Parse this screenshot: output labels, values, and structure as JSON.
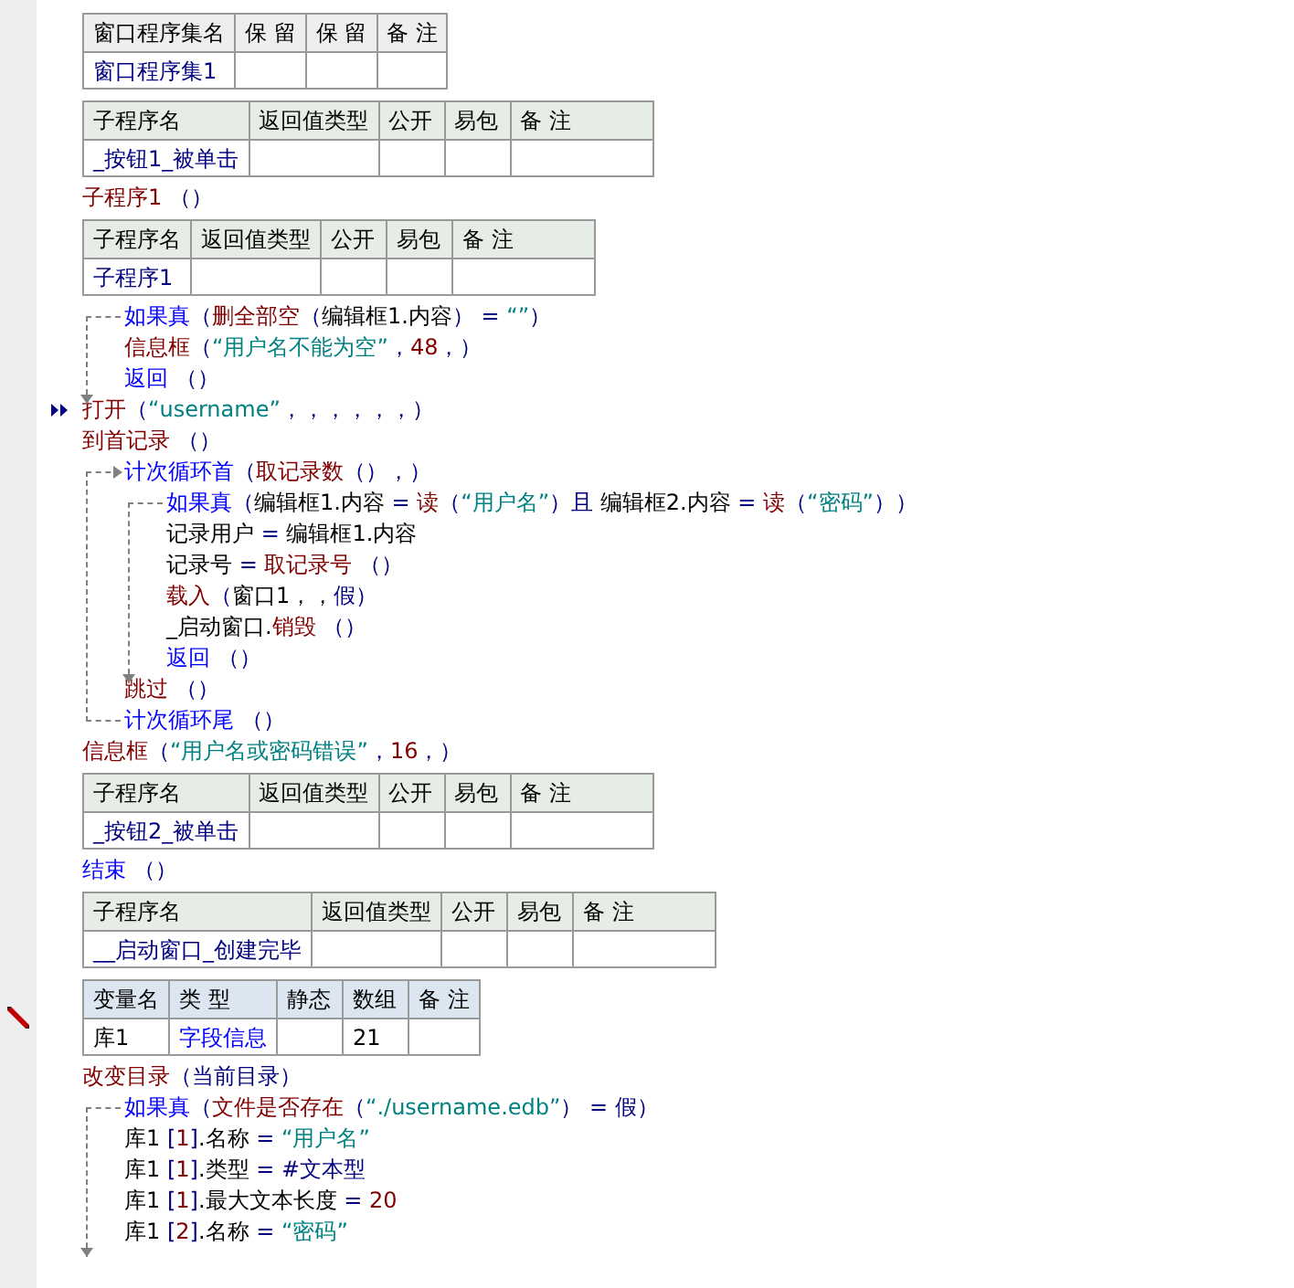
{
  "editor": {
    "blocks": [
      {
        "kind": "assembly_table",
        "editing": false,
        "columns": [
          "窗口程序集名",
          "保 留",
          "保 留",
          "备 注"
        ],
        "rows": [
          [
            "窗口程序集1"
          ]
        ]
      },
      {
        "kind": "subprogram_table",
        "editing": false,
        "columns": [
          "子程序名",
          "返回值类型",
          "公开",
          "易包",
          "备 注"
        ],
        "rows": [
          [
            "_按钮1_被单击"
          ]
        ]
      },
      {
        "kind": "line",
        "current": false,
        "segments": [
          {
            "text": "子程序1",
            "kind": "command"
          },
          {
            "text": " （）",
            "kind": "symbol"
          }
        ]
      },
      {
        "kind": "subprogram_table",
        "editing": false,
        "columns": [
          "子程序名",
          "返回值类型",
          "公开",
          "易包",
          "备 注"
        ],
        "rows": [
          [
            "子程序1"
          ]
        ]
      },
      {
        "kind": "if",
        "head": [
          {
            "text": "如果真",
            "kind": "keyword"
          },
          {
            "text": "（",
            "kind": "symbol"
          },
          {
            "text": "删全部空",
            "kind": "command"
          },
          {
            "text": "（",
            "kind": "symbol"
          },
          {
            "text": "编辑框1.内容",
            "kind": "plain"
          },
          {
            "text": "） =  ",
            "kind": "symbol"
          },
          {
            "text": "“”",
            "kind": "string"
          },
          {
            "text": "）",
            "kind": "symbol"
          }
        ],
        "children": [
          {
            "kind": "line",
            "segments": [
              {
                "text": "信息框",
                "kind": "command"
              },
              {
                "text": "（",
                "kind": "symbol"
              },
              {
                "text": "“用户名不能为空”",
                "kind": "string"
              },
              {
                "text": "，",
                "kind": "symbol"
              },
              {
                "text": "48",
                "kind": "number"
              },
              {
                "text": "，）",
                "kind": "symbol"
              }
            ]
          },
          {
            "kind": "line",
            "segments": [
              {
                "text": "返回",
                "kind": "keyword"
              },
              {
                "text": " （）",
                "kind": "symbol"
              }
            ]
          }
        ]
      },
      {
        "kind": "line",
        "current": true,
        "segments": [
          {
            "text": "打开",
            "kind": "command"
          },
          {
            "text": "（",
            "kind": "symbol"
          },
          {
            "text": "“username”",
            "kind": "string"
          },
          {
            "text": "，，，，，，）",
            "kind": "symbol"
          }
        ]
      },
      {
        "kind": "line",
        "current": false,
        "segments": [
          {
            "text": "到首记录",
            "kind": "command"
          },
          {
            "text": " （）",
            "kind": "symbol"
          }
        ]
      },
      {
        "kind": "loop",
        "head": [
          {
            "text": "计次循环首",
            "kind": "keyword"
          },
          {
            "text": "（",
            "kind": "symbol"
          },
          {
            "text": "取记录数",
            "kind": "command"
          },
          {
            "text": "（），）",
            "kind": "symbol"
          }
        ],
        "children": [
          {
            "kind": "if",
            "head": [
              {
                "text": "如果真",
                "kind": "keyword"
              },
              {
                "text": "（",
                "kind": "symbol"
              },
              {
                "text": "编辑框1.内容",
                "kind": "plain"
              },
              {
                "text": " = ",
                "kind": "symbol"
              },
              {
                "text": "读",
                "kind": "command"
              },
              {
                "text": "（",
                "kind": "symbol"
              },
              {
                "text": "“用户名”",
                "kind": "string"
              },
              {
                "text": "）且 ",
                "kind": "symbol"
              },
              {
                "text": "编辑框2.内容",
                "kind": "plain"
              },
              {
                "text": " = ",
                "kind": "symbol"
              },
              {
                "text": "读",
                "kind": "command"
              },
              {
                "text": "（",
                "kind": "symbol"
              },
              {
                "text": "“密码”",
                "kind": "string"
              },
              {
                "text": "））",
                "kind": "symbol"
              }
            ],
            "children": [
              {
                "kind": "line",
                "segments": [
                  {
                    "text": "记录用户",
                    "kind": "plain"
                  },
                  {
                    "text": " = ",
                    "kind": "symbol"
                  },
                  {
                    "text": "编辑框1.内容",
                    "kind": "plain"
                  }
                ]
              },
              {
                "kind": "line",
                "segments": [
                  {
                    "text": "记录号",
                    "kind": "plain"
                  },
                  {
                    "text": " = ",
                    "kind": "symbol"
                  },
                  {
                    "text": "取记录号",
                    "kind": "command"
                  },
                  {
                    "text": " （）",
                    "kind": "symbol"
                  }
                ]
              },
              {
                "kind": "line",
                "segments": [
                  {
                    "text": "载入",
                    "kind": "command"
                  },
                  {
                    "text": "（",
                    "kind": "symbol"
                  },
                  {
                    "text": "窗口1，，",
                    "kind": "plain"
                  },
                  {
                    "text": "假）",
                    "kind": "symbol"
                  }
                ]
              },
              {
                "kind": "line",
                "segments": [
                  {
                    "text": "_启动窗口.",
                    "kind": "plain"
                  },
                  {
                    "text": "销毁",
                    "kind": "command"
                  },
                  {
                    "text": " （）",
                    "kind": "symbol"
                  }
                ]
              },
              {
                "kind": "line",
                "segments": [
                  {
                    "text": "返回",
                    "kind": "keyword"
                  },
                  {
                    "text": " （）",
                    "kind": "symbol"
                  }
                ]
              }
            ]
          },
          {
            "kind": "line",
            "segments": [
              {
                "text": "跳过",
                "kind": "command"
              },
              {
                "text": " （）",
                "kind": "symbol"
              }
            ]
          }
        ],
        "tail": [
          {
            "text": "计次循环尾",
            "kind": "keyword"
          },
          {
            "text": " （）",
            "kind": "symbol"
          }
        ]
      },
      {
        "kind": "line",
        "current": false,
        "segments": [
          {
            "text": "信息框",
            "kind": "command"
          },
          {
            "text": "（",
            "kind": "symbol"
          },
          {
            "text": "“用户名或密码错误”",
            "kind": "string"
          },
          {
            "text": "，",
            "kind": "symbol"
          },
          {
            "text": "16",
            "kind": "number"
          },
          {
            "text": "，）",
            "kind": "symbol"
          }
        ]
      },
      {
        "kind": "subprogram_table",
        "editing": false,
        "columns": [
          "子程序名",
          "返回值类型",
          "公开",
          "易包",
          "备 注"
        ],
        "rows": [
          [
            "_按钮2_被单击"
          ]
        ]
      },
      {
        "kind": "line",
        "current": false,
        "segments": [
          {
            "text": "结束",
            "kind": "keyword"
          },
          {
            "text": " （）",
            "kind": "symbol"
          }
        ]
      },
      {
        "kind": "subprogram_table",
        "editing": false,
        "columns": [
          "子程序名",
          "返回值类型",
          "公开",
          "易包",
          "备 注"
        ],
        "rows": [
          [
            "__启动窗口_创建完毕"
          ]
        ]
      },
      {
        "kind": "variable_table",
        "editing": true,
        "columns": [
          "变量名",
          "类 型",
          "静态",
          "数组",
          "备 注"
        ],
        "rows": [
          [
            "库1",
            "字段信息",
            null,
            "21"
          ]
        ]
      },
      {
        "kind": "line",
        "current": false,
        "segments": [
          {
            "text": "改变目录",
            "kind": "command"
          },
          {
            "text": "（当前目录）",
            "kind": "symbol"
          }
        ]
      },
      {
        "kind": "if",
        "head": [
          {
            "text": "如果真",
            "kind": "keyword"
          },
          {
            "text": "（",
            "kind": "symbol"
          },
          {
            "text": "文件是否存在",
            "kind": "command"
          },
          {
            "text": "（",
            "kind": "symbol"
          },
          {
            "text": "“./username.edb”",
            "kind": "string"
          },
          {
            "text": "） = 假）",
            "kind": "symbol"
          }
        ],
        "children": [
          {
            "kind": "line",
            "segments": [
              {
                "text": "库1 ",
                "kind": "plain"
              },
              {
                "text": "[",
                "kind": "symbol"
              },
              {
                "text": "1",
                "kind": "number"
              },
              {
                "text": "]",
                "kind": "symbol"
              },
              {
                "text": ".名称",
                "kind": "plain"
              },
              {
                "text": " = ",
                "kind": "symbol"
              },
              {
                "text": "“用户名”",
                "kind": "string"
              }
            ]
          },
          {
            "kind": "line",
            "segments": [
              {
                "text": "库1 ",
                "kind": "plain"
              },
              {
                "text": "[",
                "kind": "symbol"
              },
              {
                "text": "1",
                "kind": "number"
              },
              {
                "text": "]",
                "kind": "symbol"
              },
              {
                "text": ".类型",
                "kind": "plain"
              },
              {
                "text": " = #文本型",
                "kind": "symbol"
              }
            ]
          },
          {
            "kind": "line",
            "segments": [
              {
                "text": "库1 ",
                "kind": "plain"
              },
              {
                "text": "[",
                "kind": "symbol"
              },
              {
                "text": "1",
                "kind": "number"
              },
              {
                "text": "]",
                "kind": "symbol"
              },
              {
                "text": ".最大文本长度",
                "kind": "plain"
              },
              {
                "text": " = ",
                "kind": "symbol"
              },
              {
                "text": "20",
                "kind": "number"
              }
            ]
          },
          {
            "kind": "line",
            "segments": [
              {
                "text": "库1 ",
                "kind": "plain"
              },
              {
                "text": "[",
                "kind": "symbol"
              },
              {
                "text": "2",
                "kind": "number"
              },
              {
                "text": "]",
                "kind": "symbol"
              },
              {
                "text": ".名称",
                "kind": "plain"
              },
              {
                "text": " = ",
                "kind": "symbol"
              },
              {
                "text": "“密码”",
                "kind": "string"
              }
            ]
          }
        ]
      }
    ]
  }
}
